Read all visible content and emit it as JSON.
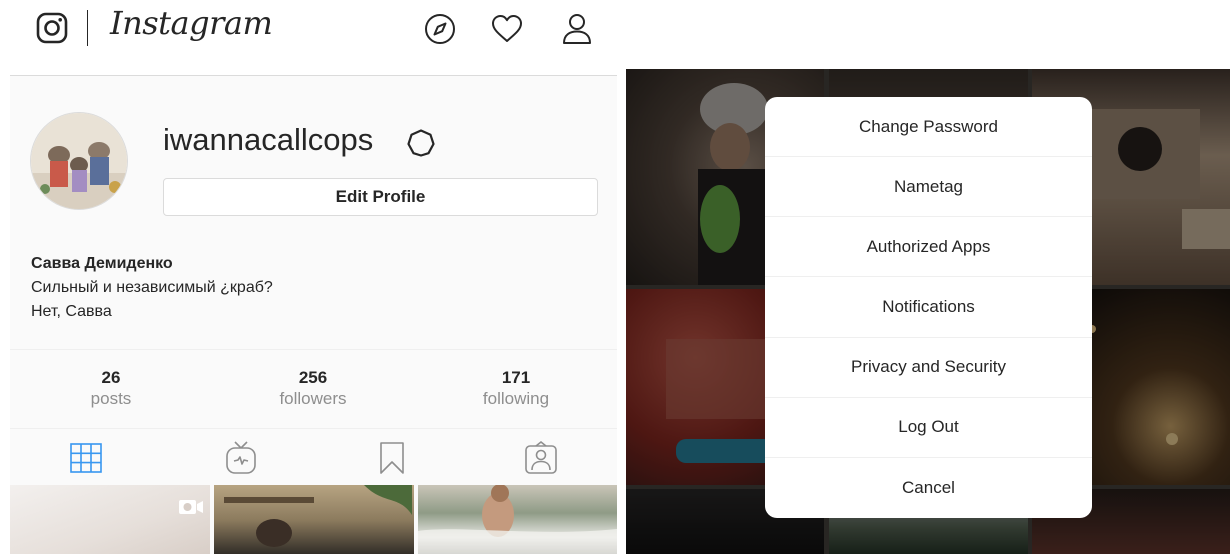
{
  "header": {
    "brand": "Instagram"
  },
  "profile": {
    "username": "iwannacallcops",
    "edit_button": "Edit Profile",
    "full_name": "Савва Демиденко",
    "bio_line1": "Сильный и независимый ¿краб?",
    "bio_line2": "Нет, Савва"
  },
  "stats": {
    "posts": {
      "value": "26",
      "label": "posts"
    },
    "followers": {
      "value": "256",
      "label": "followers"
    },
    "following": {
      "value": "171",
      "label": "following"
    }
  },
  "tabs": {
    "active": "grid"
  },
  "menu": {
    "items": [
      "Change Password",
      "Nametag",
      "Authorized Apps",
      "Notifications",
      "Privacy and Security",
      "Log Out",
      "Cancel"
    ]
  },
  "colors": {
    "accent": "#3897f0",
    "text": "#262626",
    "muted": "#8e8e8e",
    "border": "#dbdbdb"
  }
}
